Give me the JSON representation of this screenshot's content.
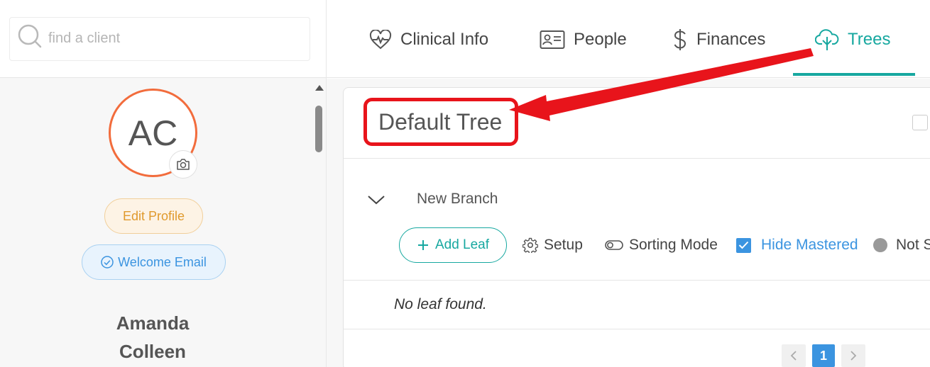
{
  "search": {
    "placeholder": "find a client"
  },
  "profile": {
    "initials": "AC",
    "edit_label": "Edit Profile",
    "welcome_label": "Welcome Email",
    "first_name": "Amanda",
    "last_name": "Colleen"
  },
  "nav": {
    "tabs": [
      {
        "label": "Clinical Info",
        "icon": "heartbeat-icon"
      },
      {
        "label": "People",
        "icon": "id-card-icon"
      },
      {
        "label": "Finances",
        "icon": "dollar-icon"
      },
      {
        "label": "Trees",
        "icon": "tree-icon",
        "active": true
      }
    ]
  },
  "tree": {
    "title": "Default Tree",
    "branch": "New Branch",
    "add_leaf_label": "Add Leaf",
    "setup_label": "Setup",
    "sorting_label": "Sorting Mode",
    "hide_mastered_label": "Hide Mastered",
    "hide_mastered_checked": true,
    "not_label": "Not S",
    "empty_message": "No leaf found."
  },
  "pagination": {
    "current": "1"
  },
  "colors": {
    "accent": "#17a8a0",
    "blue": "#3b94e0",
    "annotation": "#e8141b",
    "avatar_ring": "#f26c3c"
  }
}
